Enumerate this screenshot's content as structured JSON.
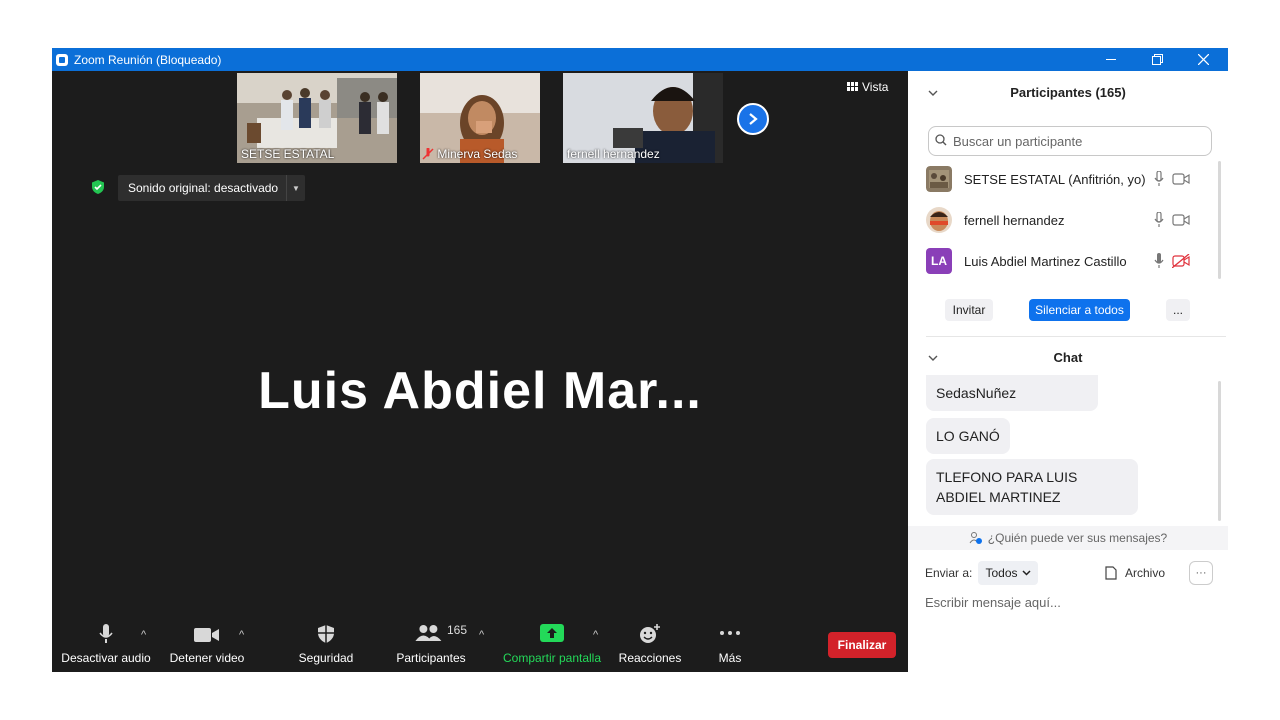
{
  "window": {
    "title": "Zoom Reunión (Bloqueado)"
  },
  "stage": {
    "thumbnails": [
      {
        "name": "SETSE ESTATAL"
      },
      {
        "name": "Minerva Sedas"
      },
      {
        "name": "fernell hernandez"
      }
    ],
    "view_label": "Vista",
    "sound_label": "Sonido original: desactivado",
    "speaker_name": "Luis  Abdiel  Mar..."
  },
  "toolbar": {
    "audio": "Desactivar audio",
    "video": "Detener video",
    "security": "Seguridad",
    "participants": "Participantes",
    "participants_count": "165",
    "share": "Compartir pantalla",
    "reactions": "Reacciones",
    "more": "Más",
    "end": "Finalizar"
  },
  "participants_panel": {
    "title": "Participantes (165)",
    "search_placeholder": "Buscar un participante",
    "participants": [
      {
        "name": "SETSE ESTATAL (Anfitrión, yo)",
        "video_muted": false
      },
      {
        "name": "fernell hernandez",
        "video_muted": false
      },
      {
        "name": "Luis Abdiel Martinez  Castillo",
        "initials": "LA",
        "video_muted": true
      }
    ],
    "invite": "Invitar",
    "mute_all": "Silenciar a todos",
    "more": "..."
  },
  "chat": {
    "title": "Chat",
    "messages": [
      "SedasNuñez",
      "LO GANÓ",
      "TLEFONO PARA LUIS ABDIEL MARTINEZ"
    ],
    "who_can_see": "¿Quién puede ver sus mensajes?",
    "send_to_label": "Enviar a:",
    "send_to_value": "Todos",
    "file_label": "Archivo",
    "input_placeholder": "Escribir mensaje aquí..."
  },
  "colors": {
    "titlebar": "#0b6fd8",
    "stage_bg": "#1c1c1c",
    "end_button": "#d3222a",
    "share_green": "#23d959",
    "mute_all_button": "#0e72ed"
  }
}
